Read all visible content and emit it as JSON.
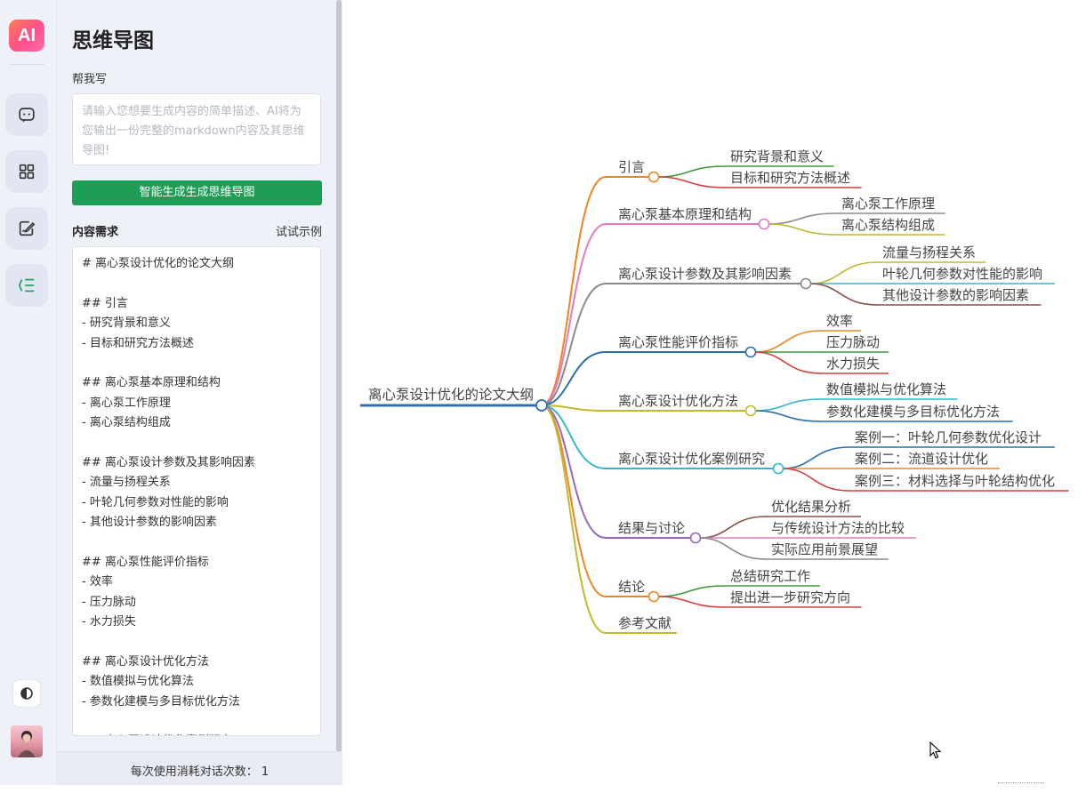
{
  "app": {
    "logo_text": "AI",
    "brand_gradient": [
      "#ff7a59",
      "#ff4f8b"
    ]
  },
  "rail": {
    "items": [
      {
        "name": "chat",
        "icon": "chat-bubble-icon"
      },
      {
        "name": "apps",
        "icon": "grid-icon"
      },
      {
        "name": "write",
        "icon": "edit-document-icon"
      },
      {
        "name": "mindmap",
        "icon": "mindmap-icon",
        "active": true
      }
    ],
    "theme_icon": "contrast-icon",
    "avatar": "user-avatar"
  },
  "panel": {
    "title": "思维导图",
    "help_label": "帮我写",
    "description_placeholder": "请输入您想要生成内容的简单描述、AI将为您输出一份完整的markdown内容及其思维导图!",
    "generate_button": "智能生成生成思维导图",
    "generate_color": "#1e9e55",
    "content_label": "内容需求",
    "try_example": "试试示例",
    "content_lines": [
      "# 离心泵设计优化的论文大纲",
      "",
      "## 引言",
      "- 研究背景和意义",
      "- 目标和研究方法概述",
      "",
      "## 离心泵基本原理和结构",
      "- 离心泵工作原理",
      "- 离心泵结构组成",
      "",
      "## 离心泵设计参数及其影响因素",
      "- 流量与扬程关系",
      "- 叶轮几何参数对性能的影响",
      "- 其他设计参数的影响因素",
      "",
      "## 离心泵性能评价指标",
      "- 效率",
      "- 压力脉动",
      "- 水力损失",
      "",
      "## 离心泵设计优化方法",
      "- 数值模拟与优化算法",
      "- 参数化建模与多目标优化方法",
      "",
      "## 离心泵设计优化案例研究"
    ],
    "footer": "每次使用消耗对话次数： 1"
  },
  "mindmap": {
    "root": {
      "label": "离心泵设计优化的论文大纲",
      "color": "#2f6fb0"
    },
    "branches": [
      {
        "label": "引言",
        "color": "#ee8522",
        "children": [
          {
            "label": "研究背景和意义",
            "color": "#3b9a3f"
          },
          {
            "label": "目标和研究方法概述",
            "color": "#d4403f"
          }
        ]
      },
      {
        "label": "离心泵基本原理和结构",
        "color": "#e37bbd",
        "children": [
          {
            "label": "离心泵工作原理",
            "color": "#8c8c8c"
          },
          {
            "label": "离心泵结构组成",
            "color": "#c2b92d"
          }
        ]
      },
      {
        "label": "离心泵设计参数及其影响因素",
        "color": "#8a8a8a",
        "children": [
          {
            "label": "流量与扬程关系",
            "color": "#c2b92d"
          },
          {
            "label": "叶轮几何参数对性能的影响",
            "color": "#2fb9cf"
          },
          {
            "label": "其他设计参数的影响因素",
            "color": "#8a5048"
          }
        ]
      },
      {
        "label": "离心泵性能评价指标",
        "color": "#2c6ea8",
        "children": [
          {
            "label": "效率",
            "color": "#ee8522"
          },
          {
            "label": "压力脉动",
            "color": "#3b9a3f"
          },
          {
            "label": "水力损失",
            "color": "#d4403f"
          }
        ]
      },
      {
        "label": "离心泵设计优化方法",
        "color": "#c2b92d",
        "children": [
          {
            "label": "数值模拟与优化算法",
            "color": "#2fb9cf"
          },
          {
            "label": "参数化建模与多目标优化方法",
            "color": "#2c6ea8"
          }
        ]
      },
      {
        "label": "离心泵设计优化案例研究",
        "color": "#2fb9cf",
        "children": [
          {
            "label": "案例一：叶轮几何参数优化设计",
            "color": "#2c6ea8"
          },
          {
            "label": "案例二：流道设计优化",
            "color": "#ee8522"
          },
          {
            "label": "案例三：材料选择与叶轮结构优化",
            "color": "#d4403f"
          }
        ]
      },
      {
        "label": "结果与讨论",
        "color": "#9467bd",
        "children": [
          {
            "label": "优化结果分析",
            "color": "#8a5048"
          },
          {
            "label": "与传统设计方法的比较",
            "color": "#e37bbd"
          },
          {
            "label": "实际应用前景展望",
            "color": "#8a8a8a"
          }
        ]
      },
      {
        "label": "结论",
        "color": "#ee8522",
        "children": [
          {
            "label": "总结研究工作",
            "color": "#3b9a3f"
          },
          {
            "label": "提出进一步研究方向",
            "color": "#d4403f"
          }
        ]
      },
      {
        "label": "参考文献",
        "color": "#c2b92d",
        "children": []
      }
    ]
  }
}
